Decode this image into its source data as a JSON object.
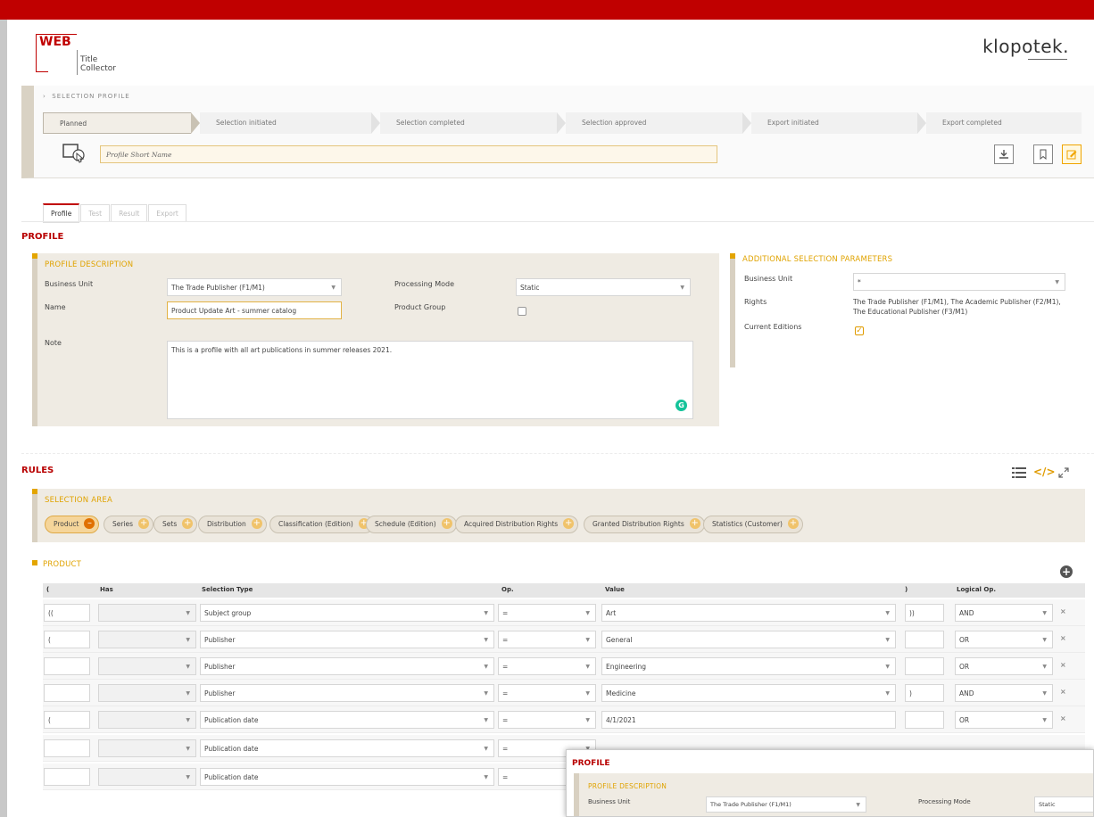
{
  "app": {
    "logo_word": "WEB",
    "logo_line1": "Title",
    "logo_line2": "Collector",
    "brand": "klopotek."
  },
  "selection_profile": {
    "title": "SELECTION PROFILE",
    "steps": [
      "Planned",
      "Selection initiated",
      "Selection completed",
      "Selection approved",
      "Export initiated",
      "Export completed"
    ],
    "short_name_placeholder": "Profile Short Name"
  },
  "tabs": [
    "Profile",
    "Test",
    "Result",
    "Export"
  ],
  "profile": {
    "section_title": "PROFILE",
    "description_title": "PROFILE DESCRIPTION",
    "business_unit_label": "Business Unit",
    "business_unit_value": "The Trade Publisher (F1/M1)",
    "processing_mode_label": "Processing Mode",
    "processing_mode_value": "Static",
    "name_label": "Name",
    "name_value": "Product Update Art - summer catalog",
    "product_group_label": "Product Group",
    "note_label": "Note",
    "note_value": "This is a profile with all art publications in summer releases 2021."
  },
  "additional": {
    "title": "ADDITIONAL SELECTION PARAMETERS",
    "business_unit_label": "Business Unit",
    "business_unit_value": "*",
    "rights_label": "Rights",
    "rights_line1": "The Trade Publisher (F1/M1), The Academic Publisher (F2/M1),",
    "rights_line2": "The Educational Publisher (F3/M1)",
    "current_editions_label": "Current Editions"
  },
  "rules": {
    "section_title": "RULES",
    "selection_area_title": "SELECTION AREA",
    "chips": [
      "Product",
      "Series",
      "Sets",
      "Distribution",
      "Classification (Edition)",
      "Schedule (Edition)",
      "Acquired Distribution Rights",
      "Granted Distribution Rights",
      "Statistics (Customer)"
    ]
  },
  "product": {
    "title": "PRODUCT",
    "headers": {
      "open": "(",
      "has": "Has",
      "selection_type": "Selection Type",
      "op": "Op.",
      "value": "Value",
      "close": ")",
      "logical": "Logical Op."
    },
    "rows": [
      {
        "open": "((",
        "type": "Subject group",
        "op": "=",
        "value": "Art",
        "close": "))",
        "logical": "AND"
      },
      {
        "open": "(",
        "type": "Publisher",
        "op": "=",
        "value": "General",
        "close": "",
        "logical": "OR"
      },
      {
        "open": "",
        "type": "Publisher",
        "op": "=",
        "value": "Engineering",
        "close": "",
        "logical": "OR"
      },
      {
        "open": "",
        "type": "Publisher",
        "op": "=",
        "value": "Medicine",
        "close": ")",
        "logical": "AND"
      },
      {
        "open": "(",
        "type": "Publication date",
        "op": "=",
        "value": "4/1/2021",
        "close": "",
        "logical": "OR"
      },
      {
        "open": "",
        "type": "Publication date",
        "op": "=",
        "value": "",
        "close": "",
        "logical": ""
      },
      {
        "open": "",
        "type": "Publication date",
        "op": "=",
        "value": "",
        "close": "",
        "logical": ""
      }
    ]
  },
  "overlay": {
    "section_title": "PROFILE",
    "description_title": "PROFILE DESCRIPTION",
    "business_unit_label": "Business Unit",
    "business_unit_value": "The Trade Publisher (F1/M1)",
    "processing_mode_label": "Processing Mode",
    "processing_mode_value": "Static"
  }
}
